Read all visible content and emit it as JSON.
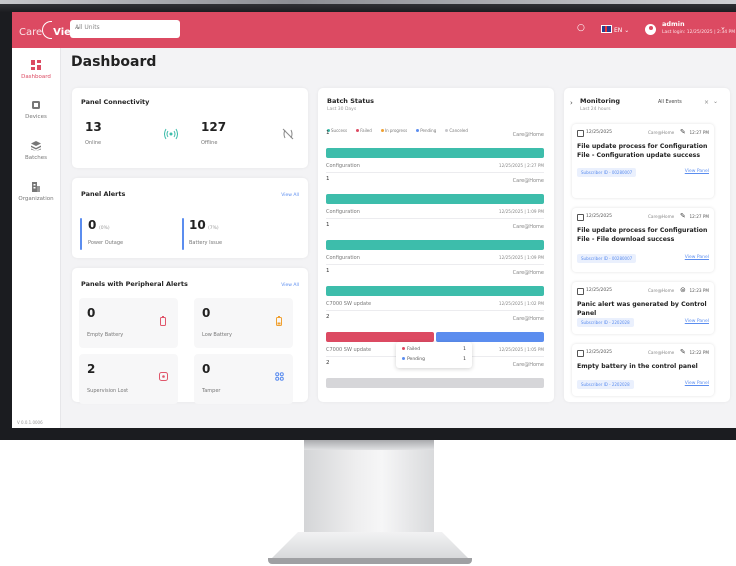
{
  "app": {
    "logo_text": "Care",
    "logo_text2": "View"
  },
  "header": {
    "unit_select": "All Units",
    "language": "EN",
    "user_name": "admin",
    "user_last_login": "Last login: 12/25/2025 | 2:34 PM"
  },
  "sidebar": {
    "items": [
      {
        "label": "Dashboard",
        "icon": "grid-icon",
        "active": true
      },
      {
        "label": "Devices",
        "icon": "device-icon"
      },
      {
        "label": "Batches",
        "icon": "stack-icon"
      },
      {
        "label": "Organization",
        "icon": "building-icon"
      }
    ],
    "version": "V 0.0.1.0006"
  },
  "page": {
    "title": "Dashboard"
  },
  "connectivity": {
    "title": "Panel Connectivity",
    "online_value": "13",
    "online_label": "Online",
    "offline_value": "127",
    "offline_label": "Offline"
  },
  "alerts": {
    "title": "Panel Alerts",
    "view_all": "View All",
    "power_value": "0",
    "power_pct": "(0%)",
    "power_label": "Power Outage",
    "battery_value": "10",
    "battery_pct": "(7%)",
    "battery_label": "Battery Issue"
  },
  "peripheral": {
    "title": "Panels with Peripheral Alerts",
    "view_all": "View All",
    "tiles": [
      {
        "value": "0",
        "label": "Empty Battery",
        "icon": "battery-empty-icon",
        "color": "#e0566b"
      },
      {
        "value": "0",
        "label": "Low Battery",
        "icon": "battery-low-icon",
        "color": "#f0a030"
      },
      {
        "value": "2",
        "label": "Supervision Lost",
        "icon": "supervision-icon",
        "color": "#e0566b"
      },
      {
        "value": "0",
        "label": "Tamper",
        "icon": "tamper-icon",
        "color": "#5b8def"
      }
    ]
  },
  "batch": {
    "title": "Batch Status",
    "subtitle": "Last 30 Days",
    "legend": [
      {
        "label": "Success",
        "color": "#3dbdab"
      },
      {
        "label": "Failed",
        "color": "#dc4a62"
      },
      {
        "label": "In progress",
        "color": "#f0a030"
      },
      {
        "label": "Pending",
        "color": "#5b8def"
      },
      {
        "label": "Canceled",
        "color": "#c8c8cc"
      }
    ],
    "rows": [
      {
        "count": "1",
        "org": "Care@Home",
        "type": "Configuration",
        "date": "12/25/2025 | 2:27 PM"
      },
      {
        "count": "1",
        "org": "Care@Home",
        "type": "Configuration",
        "date": "12/25/2025 | 1:09 PM"
      },
      {
        "count": "1",
        "org": "Care@Home",
        "type": "Configuration",
        "date": "12/25/2025 | 1:09 PM"
      },
      {
        "count": "1",
        "org": "Care@Home",
        "type": "C7000 SW update",
        "date": "12/25/2025 | 1:02 PM"
      },
      {
        "count": "2",
        "org": "Care@Home",
        "type": "C7000 SW update",
        "date": "12/25/2025 | 1:05 PM"
      },
      {
        "count": "2",
        "org": "Care@Home",
        "type": "",
        "date": ""
      }
    ],
    "tooltip": [
      {
        "label": "Failed",
        "value": "1",
        "color": "#dc4a62"
      },
      {
        "label": "Pending",
        "value": "1",
        "color": "#5b8def"
      }
    ]
  },
  "monitoring": {
    "title": "Monitoring",
    "subtitle": "Last 24 hours",
    "filter": "All Events",
    "clear": "×",
    "events": [
      {
        "date": "12/25/2025",
        "org": "Care@Home",
        "time": "12:27 PM",
        "icon": "pencil-icon",
        "title": "File update process for Configuration File - Configuration update success",
        "subscriber": "Subscriber ID - 00280007",
        "view": "View Panel"
      },
      {
        "date": "12/25/2025",
        "org": "Care@Home",
        "time": "12:27 PM",
        "icon": "pencil-icon",
        "title": "File update process for Configuration File - File download success",
        "subscriber": "Subscriber ID - 00280007",
        "view": "View Panel"
      },
      {
        "date": "12/25/2025",
        "org": "Care@Home",
        "time": "12:23 PM",
        "icon": "alert-icon",
        "title": "Panic alert was generated by Control Panel",
        "subscriber": "Subscriber ID - 2202028",
        "view": "View Panel"
      },
      {
        "date": "12/25/2025",
        "org": "Care@Home",
        "time": "12:22 PM",
        "icon": "pencil-icon",
        "title": "Empty battery in the control panel",
        "subscriber": "Subscriber ID - 2202028",
        "view": "View Panel"
      }
    ]
  }
}
